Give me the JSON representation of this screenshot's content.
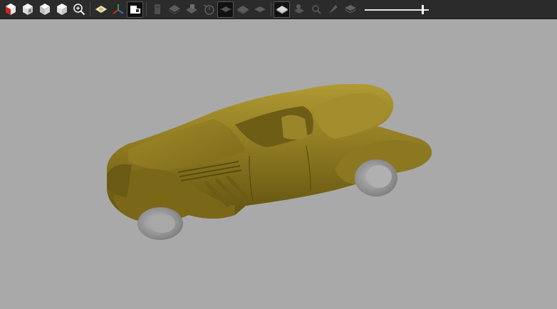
{
  "toolbar": {
    "buttons": [
      {
        "name": "view-cube-iso-icon",
        "state": "normal"
      },
      {
        "name": "view-cube-front-icon",
        "state": "normal"
      },
      {
        "name": "view-cube-top-icon",
        "state": "normal"
      },
      {
        "name": "view-cube-side-icon",
        "state": "normal"
      },
      {
        "name": "zoom-fit-icon",
        "state": "normal"
      },
      {
        "name": "shaded-plane-icon",
        "state": "normal"
      },
      {
        "name": "axis-triad-icon",
        "state": "normal"
      },
      {
        "name": "section-view-icon",
        "state": "active"
      },
      {
        "name": "clip-box-icon",
        "state": "disabled"
      },
      {
        "name": "layer-stack-icon",
        "state": "disabled"
      },
      {
        "name": "layer-edit-icon",
        "state": "disabled"
      },
      {
        "name": "timer-icon",
        "state": "disabled"
      },
      {
        "name": "explode-view-icon",
        "state": "active-dim"
      },
      {
        "name": "layer-solid-icon",
        "state": "disabled"
      },
      {
        "name": "layer-flat-icon",
        "state": "disabled"
      },
      {
        "name": "shaded-solid-icon",
        "state": "active"
      },
      {
        "name": "gear-layer-icon",
        "state": "disabled"
      },
      {
        "name": "measure-icon",
        "state": "disabled"
      },
      {
        "name": "pin-icon",
        "state": "disabled"
      },
      {
        "name": "layers-icon",
        "state": "disabled"
      }
    ],
    "slider_value": 0.92
  },
  "viewport": {
    "background": "#a9a9a9",
    "model_color": "#8c7a1e",
    "tire_color": "#9a9a9a"
  }
}
